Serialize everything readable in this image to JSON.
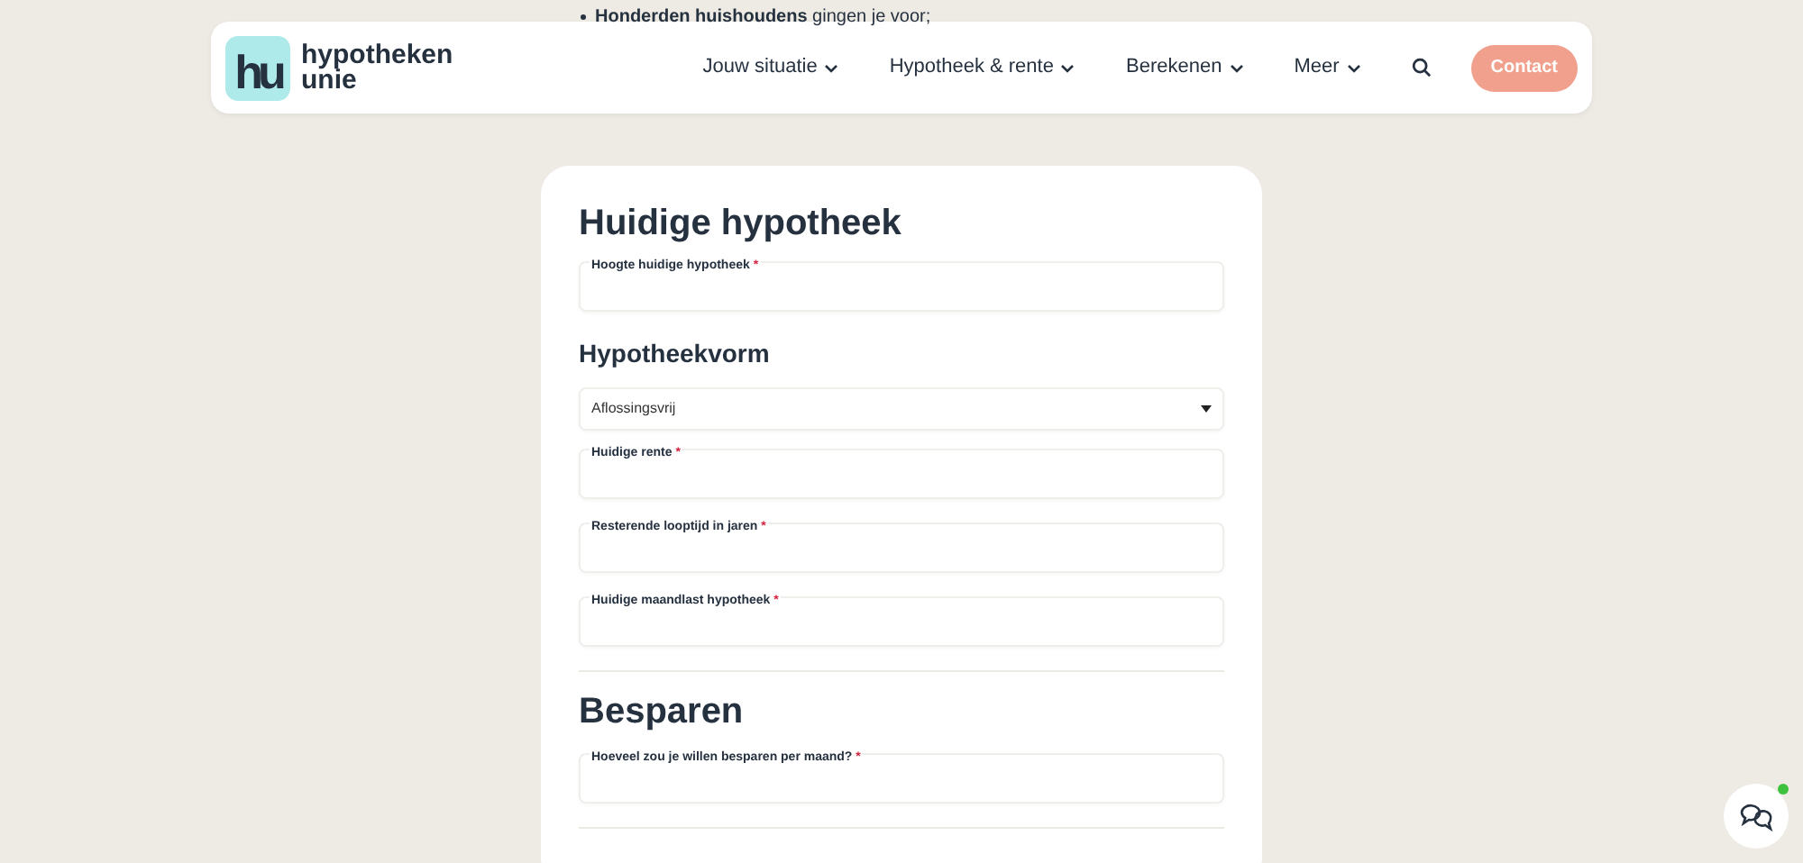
{
  "intro_bullet": "**Honderden huishoudens** gingen je voor;",
  "header": {
    "logo_mark": "h",
    "logo_mark_2": "u",
    "brand_line_1": "hypotheken",
    "brand_line_2": "unie",
    "nav": [
      {
        "label": "Jouw situatie"
      },
      {
        "label": "Hypotheek & rente"
      },
      {
        "label": "Berekenen"
      },
      {
        "label": "Meer"
      }
    ],
    "contact_button": "Contact"
  },
  "form": [
    {
      "kind": "heading",
      "text": "Huidige hypotheek"
    },
    {
      "kind": "field",
      "label": "Hoogte huidige hypotheek",
      "required_mark": "*"
    },
    {
      "kind": "subheading",
      "text": "Hypotheekvorm"
    },
    {
      "kind": "select",
      "value": "Aflossingsvrij"
    },
    {
      "kind": "field",
      "label": "Huidige rente",
      "required_mark": "*"
    },
    {
      "kind": "field",
      "label": "Resterende looptijd in jaren",
      "required_mark": "*"
    },
    {
      "kind": "field",
      "label": "Huidige maandlast hypotheek",
      "required_mark": "*"
    },
    {
      "kind": "divider"
    },
    {
      "kind": "heading",
      "text": "Besparen"
    },
    {
      "kind": "field",
      "label": "Hoeveel zou je willen besparen per maand?",
      "required_mark": "*"
    },
    {
      "kind": "divider"
    }
  ],
  "chat": {
    "online": true
  }
}
